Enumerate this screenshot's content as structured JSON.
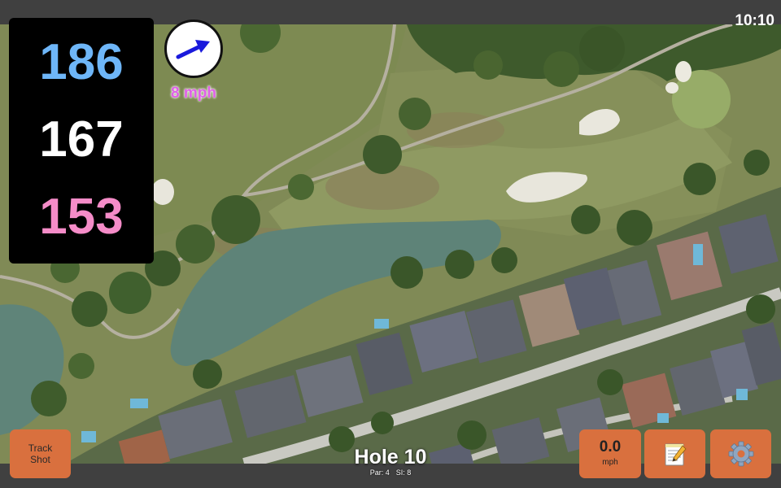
{
  "status_bar": {
    "time": "10:10"
  },
  "yardage": {
    "back": "186",
    "middle": "167",
    "front": "153"
  },
  "wind": {
    "speed": "8 mph",
    "icon": "arrow-icon",
    "arrow_color": "#1a1adc"
  },
  "hole": {
    "title": "Hole 10",
    "par": "Par: 4",
    "stroke_index": "SI: 8"
  },
  "controls": {
    "track_shot": {
      "line1": "Track",
      "line2": "Shot"
    },
    "speed": {
      "value": "0.0",
      "unit": "mph"
    },
    "notes_icon": "notepad-icon",
    "settings_icon": "gear-icon"
  },
  "colors": {
    "button": "#d9703e",
    "yard_back": "#6eb6f8",
    "yard_middle": "#ffffff",
    "yard_front": "#f58cc8",
    "wind_text": "#e060e8"
  }
}
